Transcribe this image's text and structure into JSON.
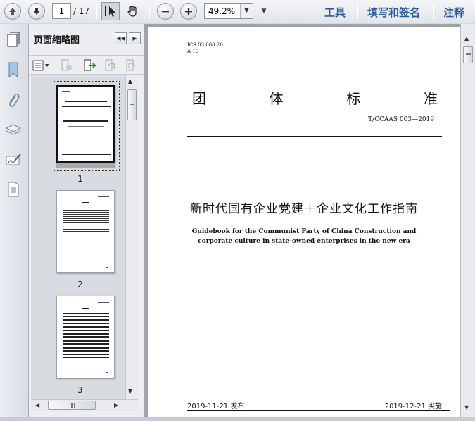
{
  "toolbar": {
    "current_page": "1",
    "total_pages": "/ 17",
    "zoom": "49.2%",
    "menu": {
      "tools": "工具",
      "fill_sign": "填写和签名",
      "comment": "注释"
    }
  },
  "panel": {
    "title": "页面缩略图",
    "thumbnails": [
      {
        "label": "1"
      },
      {
        "label": "2"
      },
      {
        "label": "3"
      }
    ]
  },
  "document": {
    "ics": "ICS  03.080.20",
    "ccs": "A  10",
    "title_chars": [
      "团",
      "体",
      "标",
      "准"
    ],
    "code": "T/CCAAS  003—2019",
    "cn_title": "新时代国有企业党建＋企业文化工作指南",
    "en_title_1": "Guidebook for the Communist Party of China Construction and",
    "en_title_2": "corporate culture in state-owned enterprises in the new era",
    "release_date": "2019-11-21 发布",
    "implement_date": "2019-12-21 实施"
  }
}
